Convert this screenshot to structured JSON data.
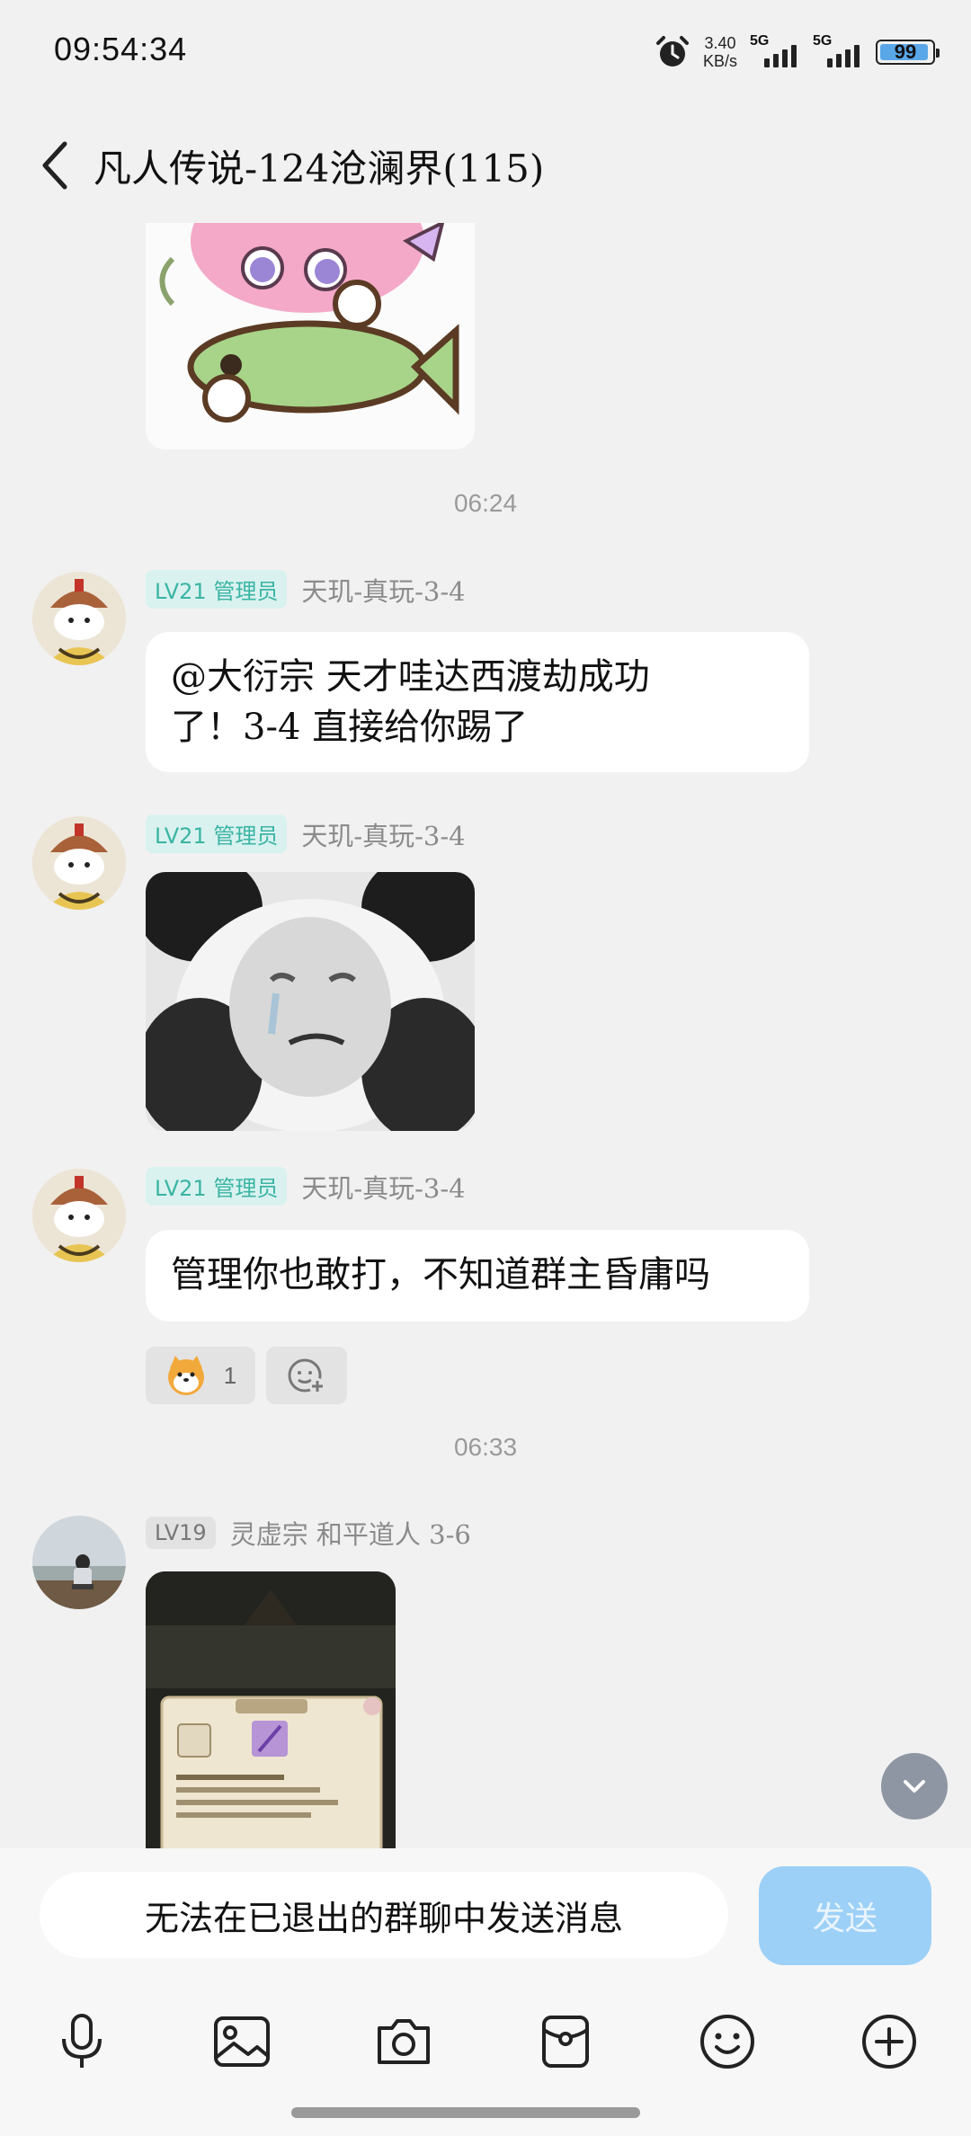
{
  "status": {
    "time": "09:54:34",
    "net_speed_value": "3.40",
    "net_speed_unit": "KB/s",
    "sim1": "5G",
    "sim2": "5G",
    "battery": "99"
  },
  "header": {
    "title": "凡人传说-124沧澜界(115)"
  },
  "chat": {
    "divider1": "06:24",
    "msg1": {
      "badge": "LV21 管理员",
      "sender": "天玑-真玩-3-4",
      "text_line1": "@大衍宗 天才哇达西渡劫成功",
      "text_line2": "了！3-4 直接给你踢了"
    },
    "msg2": {
      "badge": "LV21 管理员",
      "sender": "天玑-真玩-3-4"
    },
    "msg3": {
      "badge": "LV21 管理员",
      "sender": "天玑-真玩-3-4",
      "text": "管理你也敢打，不知道群主昏庸吗",
      "reaction_count": "1"
    },
    "divider2": "06:33",
    "msg4": {
      "badge": "LV19",
      "sender": "灵虚宗 和平道人 3-6"
    }
  },
  "input": {
    "placeholder": "无法在已退出的群聊中发送消息",
    "send_label": "发送"
  },
  "toolbar": {
    "icons": [
      "microphone-icon",
      "image-icon",
      "camera-icon",
      "red-packet-icon",
      "emoji-icon",
      "plus-icon"
    ]
  },
  "colors": {
    "admin_badge_bg": "#d9f2ef",
    "admin_badge_text": "#3ab4a4",
    "send_button": "#9dd0f7",
    "background": "#f1f1f1"
  }
}
